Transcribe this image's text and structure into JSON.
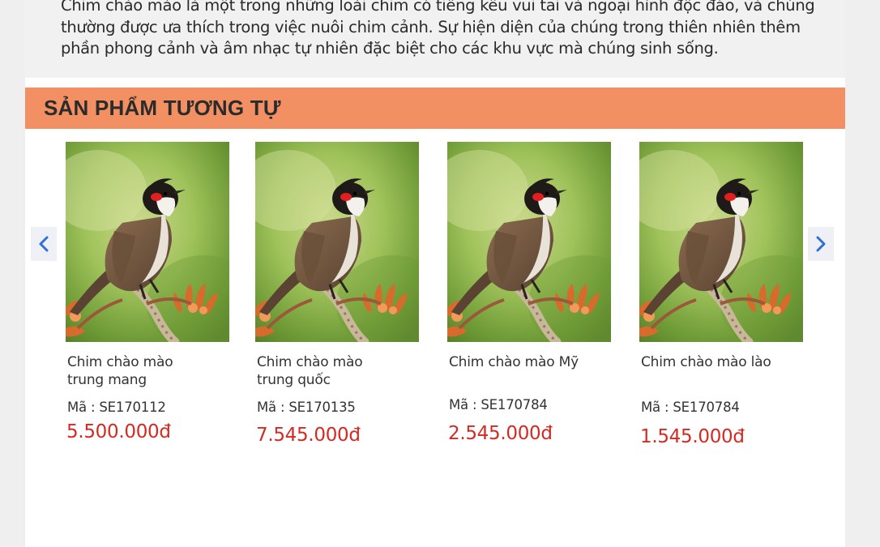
{
  "description": {
    "text": "Chim chào mào là một trong những loài chim có tiếng kêu vui tai và ngoại hình độc đáo, và chúng thường được ưa thích trong việc nuôi chim cảnh. Sự hiện diện của chúng trong thiên nhiên thêm phần phong cảnh và âm nhạc tự nhiên đặc biệt cho các khu vực mà chúng sinh sống."
  },
  "section": {
    "title": "SẢN PHẨM TƯƠNG TỰ"
  },
  "carousel": {
    "prev_icon": "chevron-left-icon",
    "next_icon": "chevron-right-icon",
    "accent_color": "#2f6fd6"
  },
  "products": [
    {
      "name": "Chim chào mào trung mang",
      "code": "Mã : SE170112",
      "price": "5.500.000đ"
    },
    {
      "name": "Chim chào mào trung quốc",
      "code": "Mã : SE170135",
      "price": "7.545.000đ"
    },
    {
      "name": "Chim chào mào Mỹ",
      "code": "Mã : SE170784",
      "price": "2.545.000đ"
    },
    {
      "name": "Chim chào mào lào",
      "code": "Mã : SE170784",
      "price": "1.545.000đ"
    }
  ],
  "colors": {
    "section_bar": "#f29063",
    "price": "#d42a22"
  }
}
